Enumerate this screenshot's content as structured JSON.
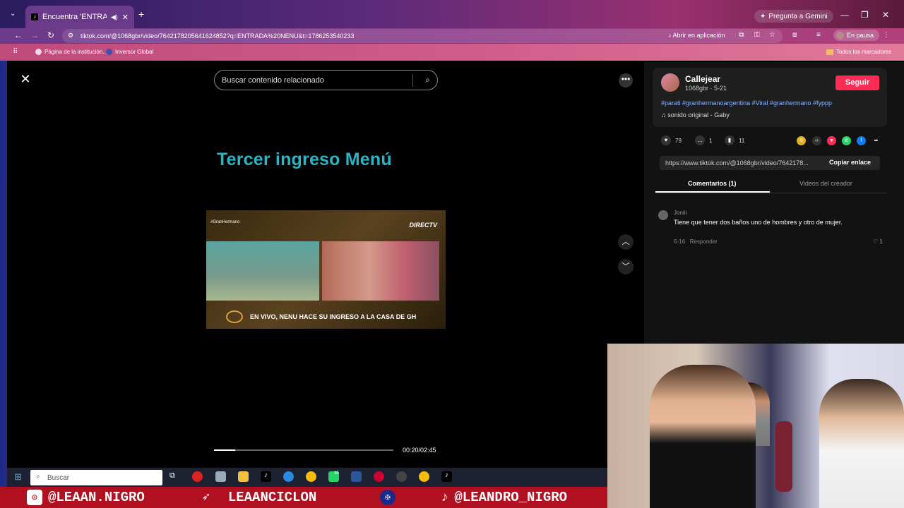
{
  "browser": {
    "tab_title": "Encuentra 'ENTRADA NENU'",
    "tab_favicon": "tiktok-icon",
    "gemini_label": "Pregunta a Gemini",
    "url": "tiktok.com/@1068gbr/video/7642178205641624852?q=ENTRADA%20NENU&t=1786253540233",
    "open_app_label": "Abrir en aplicación",
    "profile_status": "En pausa",
    "bookmarks": [
      "Página de la institución...",
      "Inversor Global"
    ],
    "all_bookmarks_label": "Todos los marcadores"
  },
  "video": {
    "search_placeholder": "Buscar contenido relacionado",
    "headline": "Tercer ingreso Menú",
    "frame_tag": "#GranHermano",
    "frame_brand": "DIRECTV",
    "frame_banner": "EN VIVO, NENU HACE SU INGRESO A LA CASA DE GH",
    "current_time": "00:20",
    "duration": "02:45",
    "time_display": "00:20/02:45",
    "progress_fraction": 0.12
  },
  "creator": {
    "name": "Callejear",
    "meta": "1068gbr · 5-21",
    "follow_label": "Seguir",
    "hashtags": "#parati #granhermanoargentina #Viral #granhermano #fyppp",
    "sound": "sonido original - Gaby"
  },
  "stats": {
    "likes": "79",
    "comments": "1",
    "saves": "11"
  },
  "share": {
    "link": "https://www.tiktok.com/@1068gbr/video/7642178...",
    "copy_label": "Copiar enlace"
  },
  "panel_tabs": {
    "comments": "Comentarios (1)",
    "creator_videos": "Videos del creador"
  },
  "comment": {
    "user": "Joniii",
    "text": "Tiene que tener dos baños uno de hombres y otro de mujer.",
    "date": "6-16",
    "reply_label": "Responder",
    "likes": "1"
  },
  "taskbar": {
    "search_placeholder": "Buscar",
    "badge": "85"
  },
  "overlay": {
    "instagram": "@LEAAN.NIGRO",
    "kick": "LEAANCICLON",
    "tiktok": "@LEANDRO_NIGRO"
  },
  "colors": {
    "accent": "#fe2c55",
    "headline": "#2bb5c4",
    "hashtag": "#8bb4ff"
  }
}
